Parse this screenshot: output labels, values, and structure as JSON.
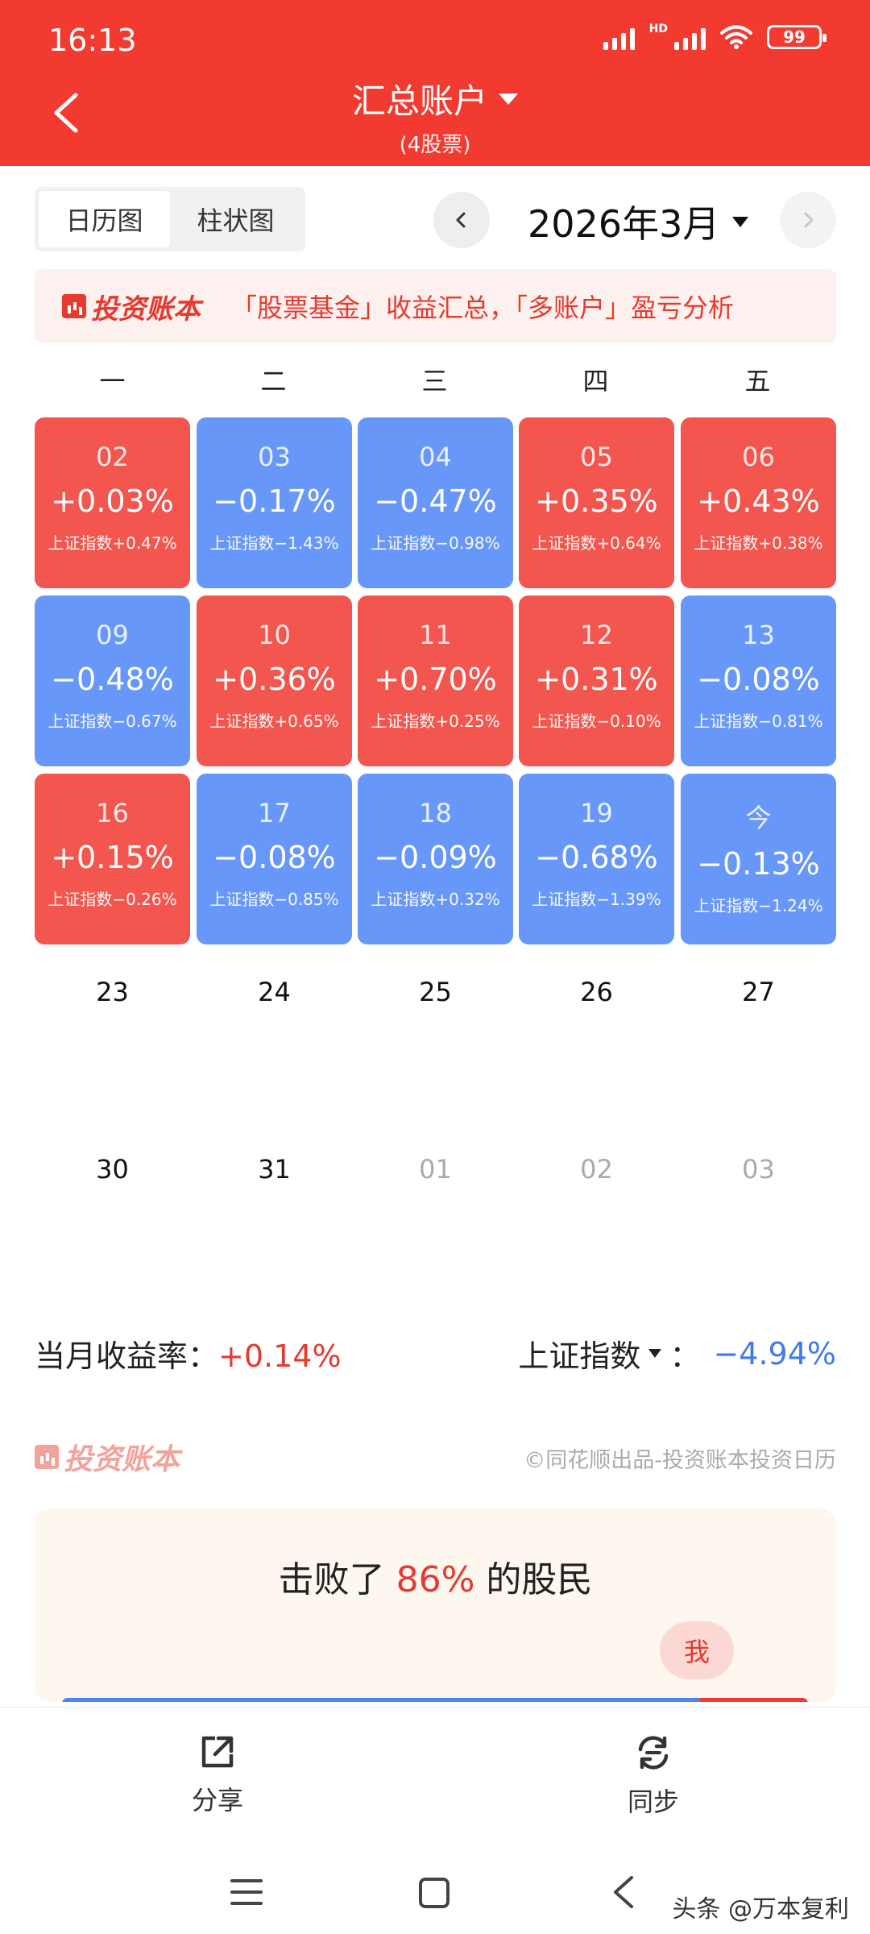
{
  "status_bar": {
    "time": "16:13",
    "network": "HD",
    "battery": "99"
  },
  "header": {
    "title": "汇总账户",
    "subtitle": "(4股票)"
  },
  "tabs": [
    {
      "label": "日历图",
      "active": true
    },
    {
      "label": "柱状图",
      "active": false
    }
  ],
  "month_selector": {
    "label": "2026年3月"
  },
  "banner": {
    "logo_text": "投资账本",
    "text": "「股票基金」收益汇总，「多账户」盈亏分析"
  },
  "calendar": {
    "weekdays": [
      "一",
      "二",
      "三",
      "四",
      "五"
    ],
    "week1": [
      {
        "day": "02",
        "pct": "+0.03%",
        "index": "上证指数+0.47%",
        "color": "red"
      },
      {
        "day": "03",
        "pct": "−0.17%",
        "index": "上证指数−1.43%",
        "color": "blue"
      },
      {
        "day": "04",
        "pct": "−0.47%",
        "index": "上证指数−0.98%",
        "color": "blue"
      },
      {
        "day": "05",
        "pct": "+0.35%",
        "index": "上证指数+0.64%",
        "color": "red"
      },
      {
        "day": "06",
        "pct": "+0.43%",
        "index": "上证指数+0.38%",
        "color": "red"
      }
    ],
    "week2": [
      {
        "day": "09",
        "pct": "−0.48%",
        "index": "上证指数−0.67%",
        "color": "blue"
      },
      {
        "day": "10",
        "pct": "+0.36%",
        "index": "上证指数+0.65%",
        "color": "red"
      },
      {
        "day": "11",
        "pct": "+0.70%",
        "index": "上证指数+0.25%",
        "color": "red"
      },
      {
        "day": "12",
        "pct": "+0.31%",
        "index": "上证指数−0.10%",
        "color": "red"
      },
      {
        "day": "13",
        "pct": "−0.08%",
        "index": "上证指数−0.81%",
        "color": "blue"
      }
    ],
    "week3": [
      {
        "day": "16",
        "pct": "+0.15%",
        "index": "上证指数−0.26%",
        "color": "red"
      },
      {
        "day": "17",
        "pct": "−0.08%",
        "index": "上证指数−0.85%",
        "color": "blue"
      },
      {
        "day": "18",
        "pct": "−0.09%",
        "index": "上证指数+0.32%",
        "color": "blue"
      },
      {
        "day": "19",
        "pct": "−0.68%",
        "index": "上证指数−1.39%",
        "color": "blue"
      },
      {
        "day": "今",
        "pct": "−0.13%",
        "index": "上证指数−1.24%",
        "color": "blue"
      }
    ],
    "week4": [
      "23",
      "24",
      "25",
      "26",
      "27"
    ],
    "week5": [
      "30",
      "31",
      "01",
      "02",
      "03"
    ]
  },
  "summary": {
    "month_return_label": "当月收益率：",
    "month_return_value": "+0.14%",
    "index_label": "上证指数",
    "index_sep": "：",
    "index_value": "−4.94%"
  },
  "footer": {
    "brand": "投资账本",
    "credit": "©同花顺出品-投资账本投资日历"
  },
  "beat_card": {
    "prefix": "击败了 ",
    "percent": "86%",
    "suffix": " 的股民",
    "me_label": "我",
    "percentile": 0.86
  },
  "actions": {
    "share": "分享",
    "sync": "同步"
  },
  "watermark": "头条 @万本复利",
  "colors": {
    "header": "#f23a31",
    "gain": "#f2564f",
    "loss": "#6797f8"
  }
}
